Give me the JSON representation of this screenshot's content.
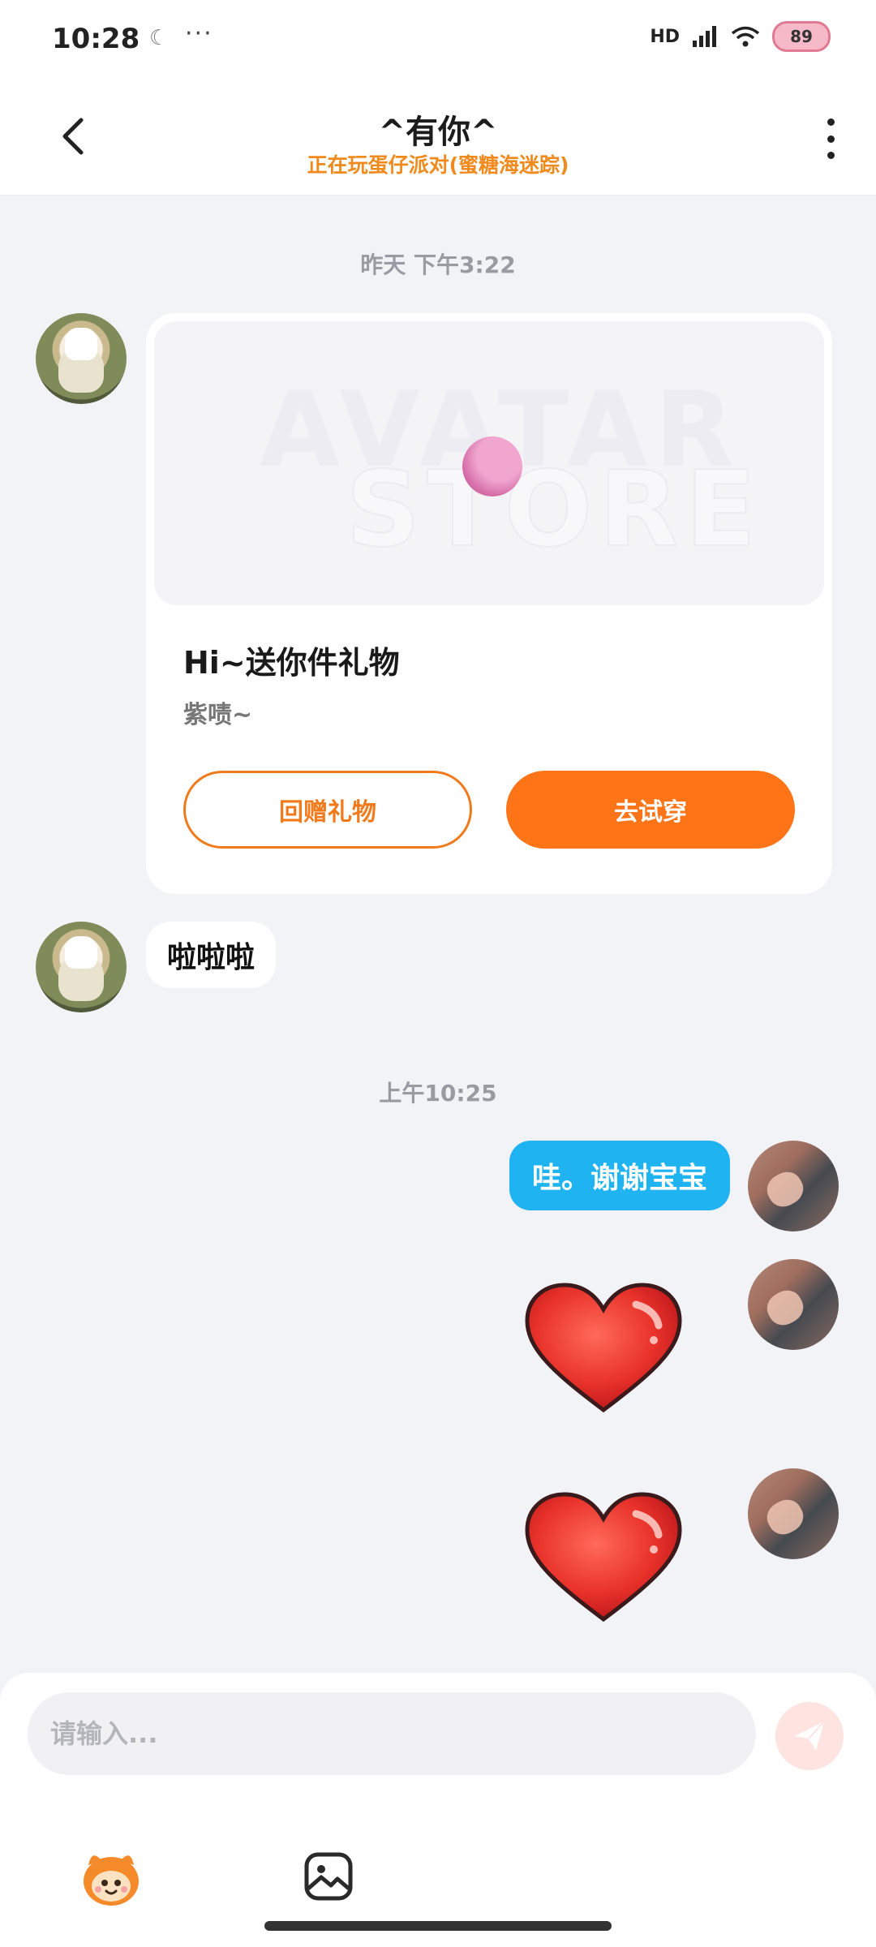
{
  "status_bar": {
    "time": "10:28",
    "moon_icon": "moon-icon",
    "more": "···",
    "hd": "HD",
    "battery": "89"
  },
  "header": {
    "title": "^有你^",
    "subtitle": "正在玩蛋仔派对(蜜糖海迷踪)"
  },
  "messages": {
    "timestamp_1": "昨天 下午3:22",
    "gift_card": {
      "watermark_line1": "AVATAR",
      "watermark_line2": "STORE",
      "title": "Hi~送你件礼物",
      "description": "紫啧~",
      "return_button": "回赠礼物",
      "try_button": "去试穿"
    },
    "bubble_in": "啦啦啦",
    "timestamp_2": "上午10:25",
    "bubble_out": "哇。谢谢宝宝"
  },
  "input": {
    "placeholder": "请输入..."
  },
  "colors": {
    "accent_orange": "#fe7416",
    "subtitle_orange": "#f08a1c",
    "bubble_blue": "#1fb3f2",
    "send_disabled": "#fde4e0",
    "background": "#f2f3f7"
  },
  "icons": {
    "back": "chevron-left-icon",
    "more": "more-vertical-icon",
    "send": "paper-plane-icon",
    "mascot": "eggy-mascot-icon",
    "image": "image-gallery-icon",
    "sticker": "heart-sticker-icon"
  }
}
